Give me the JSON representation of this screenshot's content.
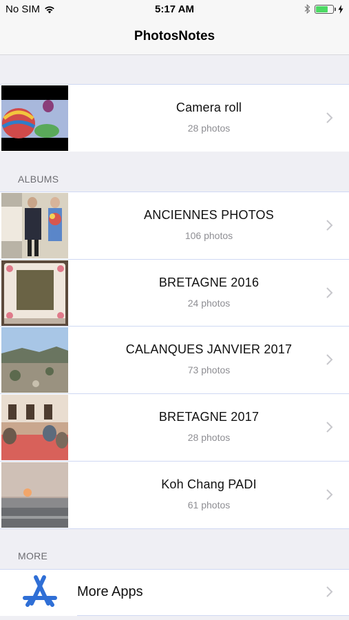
{
  "status_bar": {
    "carrier": "No SIM",
    "time": "5:17 AM",
    "battery_level": 0.7
  },
  "nav": {
    "title": "PhotosNotes"
  },
  "camera_roll": {
    "title": "Camera roll",
    "count": "28 photos"
  },
  "sections": {
    "albums": "ALBUMS",
    "more": "MORE"
  },
  "albums": [
    {
      "title": "ANCIENNES PHOTOS",
      "count": "106 photos"
    },
    {
      "title": "BRETAGNE 2016",
      "count": "24 photos"
    },
    {
      "title": "CALANQUES JANVIER 2017",
      "count": "73 photos"
    },
    {
      "title": "BRETAGNE 2017",
      "count": "28 photos"
    },
    {
      "title": "Koh Chang PADI",
      "count": "61 photos"
    }
  ],
  "more_apps": {
    "label": "More Apps",
    "icon": "app-store-icon"
  },
  "colors": {
    "accent_blue": "#2f6fd6",
    "battery_green": "#4cd964",
    "secondary_text": "#8e8e93"
  }
}
